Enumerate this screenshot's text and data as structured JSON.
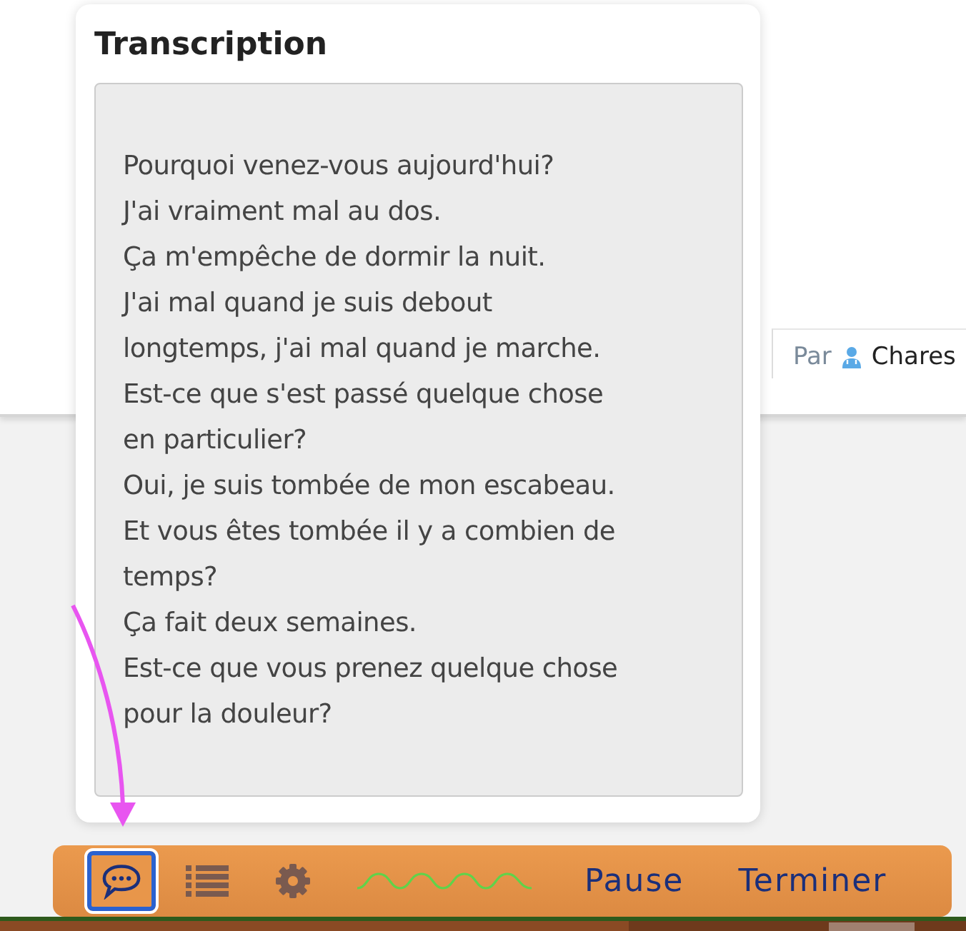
{
  "background": {
    "author_label": "Par",
    "author_name": "Chares"
  },
  "transcription": {
    "title": "Transcription",
    "lines": [
      "Pourquoi venez-vous aujourd'hui?",
      "J'ai vraiment mal au dos.",
      "Ça m'empêche de dormir la nuit.",
      "J'ai mal quand je suis debout",
      "longtemps, j'ai mal quand je marche.",
      "Est-ce que s'est passé quelque chose",
      "en particulier?",
      "Oui, je suis tombée de mon escabeau.",
      "Et vous êtes tombée il y a combien de",
      "temps?",
      "Ça fait deux semaines.",
      "Est-ce que vous prenez quelque chose",
      "pour la douleur?"
    ]
  },
  "toolbar": {
    "tools": [
      {
        "kind": "chat",
        "selected": true
      },
      {
        "kind": "list",
        "selected": false
      },
      {
        "kind": "settings",
        "selected": false
      },
      {
        "kind": "wave",
        "selected": false
      }
    ],
    "buttons": [
      "Pause",
      "Terminer"
    ]
  }
}
